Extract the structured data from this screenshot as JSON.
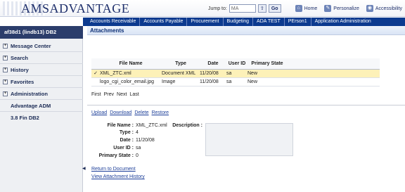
{
  "app": {
    "logo_prefix": "AMS",
    "logo_text": "ADVANTAGE"
  },
  "header": {
    "jump_label": "Jump to:",
    "jump_value": "MA",
    "go_label": "Go",
    "links": [
      {
        "label": "Home",
        "icon": "home-icon"
      },
      {
        "label": "Personalize",
        "icon": "wrench-icon"
      },
      {
        "label": "Accessibility",
        "icon": "accessibility-icon"
      }
    ]
  },
  "nav": [
    "Accounts Receivable",
    "Accounts Payable",
    "Procurement",
    "Budgeting",
    "ADA TEST",
    "PErson1",
    "Application Administration"
  ],
  "sidebar": {
    "title": "af38d1 (lindb13) DB2",
    "items": [
      {
        "label": "Message Center",
        "expandable": true
      },
      {
        "label": "Search",
        "expandable": true
      },
      {
        "label": "History",
        "expandable": true
      },
      {
        "label": "Favorites",
        "expandable": true
      },
      {
        "label": "Administration",
        "expandable": true
      },
      {
        "label": "Advantage ADM",
        "expandable": false
      },
      {
        "label": "3.8 Fin DB2",
        "expandable": false
      }
    ]
  },
  "page": {
    "title": "Attachments",
    "columns": [
      "File Name",
      "Type",
      "Date",
      "User ID",
      "Primary State"
    ],
    "rows": [
      {
        "selected": true,
        "mark": "✓",
        "file": "XML_ZTC.xml",
        "type": "Document XML",
        "date": "11/20/08",
        "user": "sa",
        "state": "New"
      },
      {
        "selected": false,
        "mark": "",
        "file": "logo_cgi_color_email.jpg",
        "type": "Image",
        "date": "11/20/08",
        "user": "sa",
        "state": "New"
      }
    ],
    "pager": [
      "First",
      "Prev",
      "Next",
      "Last"
    ],
    "actions": [
      "Upload",
      "Download",
      "Delete",
      "Restore"
    ],
    "detail": {
      "file_name_label": "File Name :",
      "file_name": "XML_ZTC.xml",
      "description_label": "Description :",
      "type_label": "Type :",
      "type": "4",
      "date_label": "Date :",
      "date": "11/20/08",
      "user_label": "User ID :",
      "user": "sa",
      "state_label": "Primary State :",
      "state": "0"
    },
    "bottom_links": [
      "Return to Document",
      "View Attachment History"
    ]
  },
  "colors": {
    "nav_bg": "#0c3a8f",
    "sidebar_head": "#2b3d6b",
    "selected_row": "#fdf1b8",
    "link": "#1d3f99"
  }
}
